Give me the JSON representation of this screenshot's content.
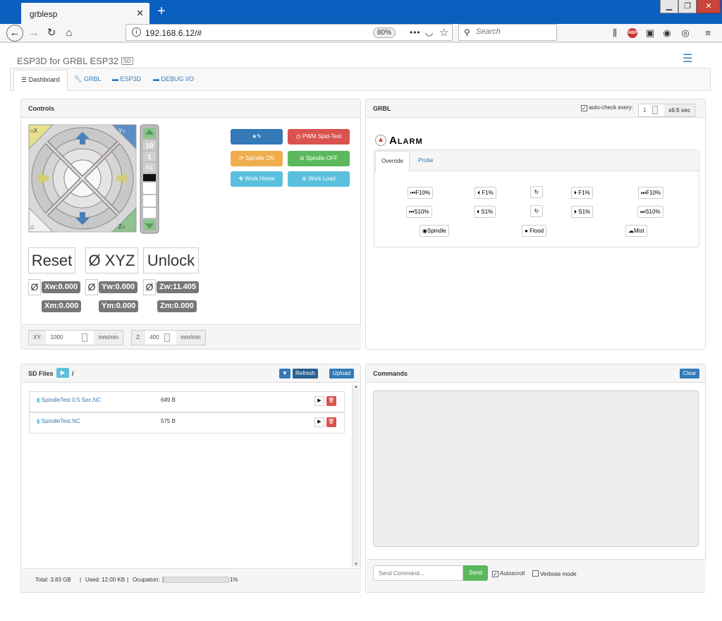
{
  "browser": {
    "tab_title": "grblesp",
    "url": "192.168.6.12/#",
    "zoom": "80%",
    "search_placeholder": "Search"
  },
  "app": {
    "title": "ESP3D for GRBL ESP32",
    "title_badge": "SD"
  },
  "nav_tabs": [
    {
      "label": "Dashboard",
      "active": true
    },
    {
      "label": "GRBL"
    },
    {
      "label": "ESP3D"
    },
    {
      "label": "DEBUG I/O"
    }
  ],
  "controls": {
    "title": "Controls",
    "jog": {
      "x_home": "X",
      "y_home": "Y",
      "z_home": "Z",
      "z_steps": [
        "10",
        "1",
        "0.1"
      ]
    },
    "macro_buttons": [
      "PWM Spid-Test",
      "Spindle ON",
      "Spindle OFF",
      "Work Home",
      "Work Load"
    ],
    "axis_buttons": [
      "Reset",
      "Ø XYZ",
      "Unlock"
    ],
    "zero_symbol": "Ø",
    "work_pos": [
      "Xw:0.000",
      "Yw:0.000",
      "Zw:11.405"
    ],
    "machine_pos": [
      "Xm:0.000",
      "Ym:0.000",
      "Zm:0.000"
    ],
    "feed": {
      "xy_label": "XY:",
      "xy_value": "1000",
      "xy_unit": "mm/min",
      "z_label": "Z:",
      "z_value": "400",
      "z_unit": "mm/min"
    }
  },
  "grbl": {
    "title": "GRBL",
    "autocheck_label": "auto-check every:",
    "autocheck_value": "1",
    "autocheck_unit": "x0.5 sec",
    "status": "Alarm",
    "subtabs": [
      "Override",
      "Probe"
    ],
    "feed_override": [
      "F10%",
      "F1%",
      "F1%",
      "F10%"
    ],
    "spindle_override": [
      "S10%",
      "S1%",
      "S1%",
      "S10%"
    ],
    "coolant": [
      "Spindle",
      "Flood",
      "Mist"
    ]
  },
  "sd": {
    "title": "SD Files",
    "path": "/",
    "refresh_label": "Refresh",
    "upload_label": "Upload",
    "files": [
      {
        "name": "SpindleTest 0.5 Sec.NC",
        "size": "649 B"
      },
      {
        "name": "SpindleTest.NC",
        "size": "575 B"
      }
    ],
    "total": "Total: 3.83 GB",
    "used": "Used: 12.00 KB",
    "occupation_label": "Ocupation:",
    "occupation_pct": "1%",
    "occupation_fraction": 0.01
  },
  "commands": {
    "title": "Commands",
    "clear_label": "Clear",
    "input_placeholder": "Send Command...",
    "send_label": "Send",
    "autoscroll_label": "Autoscroll",
    "verbose_label": "Verbose mode"
  }
}
